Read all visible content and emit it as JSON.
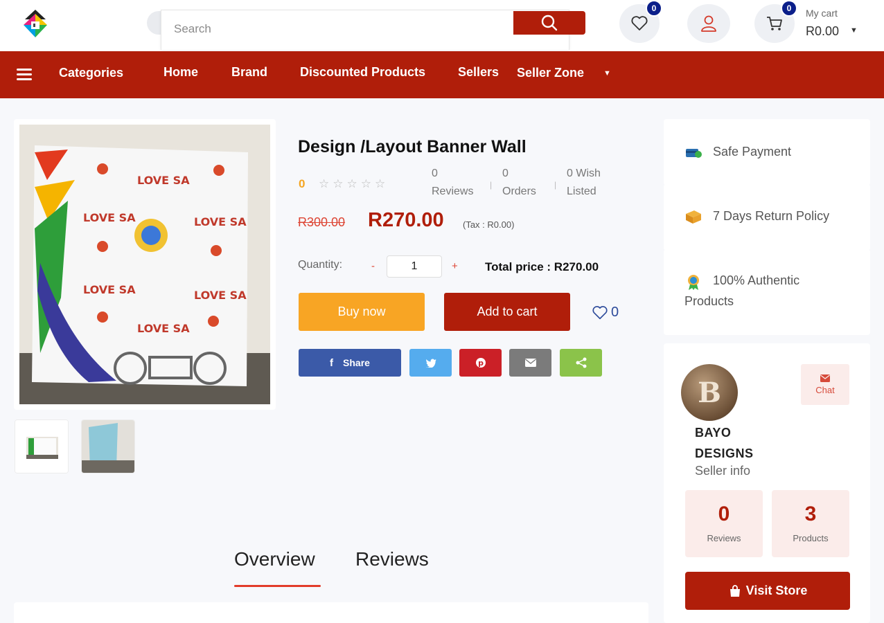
{
  "header": {
    "search_placeholder": "Search",
    "wishlist_count": "0",
    "cart_count": "0",
    "cart_label": "My cart",
    "cart_total": "R0.00"
  },
  "nav": {
    "categories": "Categories",
    "home": "Home",
    "brand": "Brand",
    "discounted": "Discounted Products",
    "sellers": "Sellers",
    "seller_zone": "Seller Zone"
  },
  "product": {
    "title": "Design /Layout Banner Wall",
    "rating": "0",
    "rating_stars": 0,
    "reviews_count": "0",
    "reviews_label": "Reviews",
    "orders_count": "0",
    "orders_label": "Orders",
    "wish_count_text": "0 Wish",
    "wish_label": "Listed",
    "old_price": "R300.00",
    "price": "R270.00",
    "tax": "(Tax : R0.00)",
    "quantity_label": "Quantity:",
    "quantity_minus": "-",
    "quantity_value": "1",
    "quantity_plus": "+",
    "total_price": "Total price : R270.00",
    "buy_now": "Buy now",
    "add_to_cart": "Add to cart",
    "wishlist_count": "0"
  },
  "share": {
    "facebook_label": "Share"
  },
  "features": {
    "safe_payment": "Safe Payment",
    "return_policy": "7 Days Return Policy",
    "authentic_line1": "100% Authentic",
    "authentic_line2": "Products"
  },
  "seller": {
    "name_line1": "BAYO",
    "name_line2": "DESIGNS",
    "info": "Seller info",
    "chat": "Chat",
    "reviews_count": "0",
    "reviews_label": "Reviews",
    "products_count": "3",
    "products_label": "Products",
    "visit_store": "Visit Store"
  },
  "tabs": {
    "overview": "Overview",
    "reviews": "Reviews",
    "active": "Overview"
  },
  "colors": {
    "brand_red": "#b01e0a",
    "buy_orange": "#f8a524",
    "badge_navy": "#0b1f8a",
    "facebook": "#3b5aa8",
    "twitter": "#55acee",
    "pinterest": "#cb2027",
    "email": "#7b7b7b",
    "sharethis": "#8bc34a"
  }
}
